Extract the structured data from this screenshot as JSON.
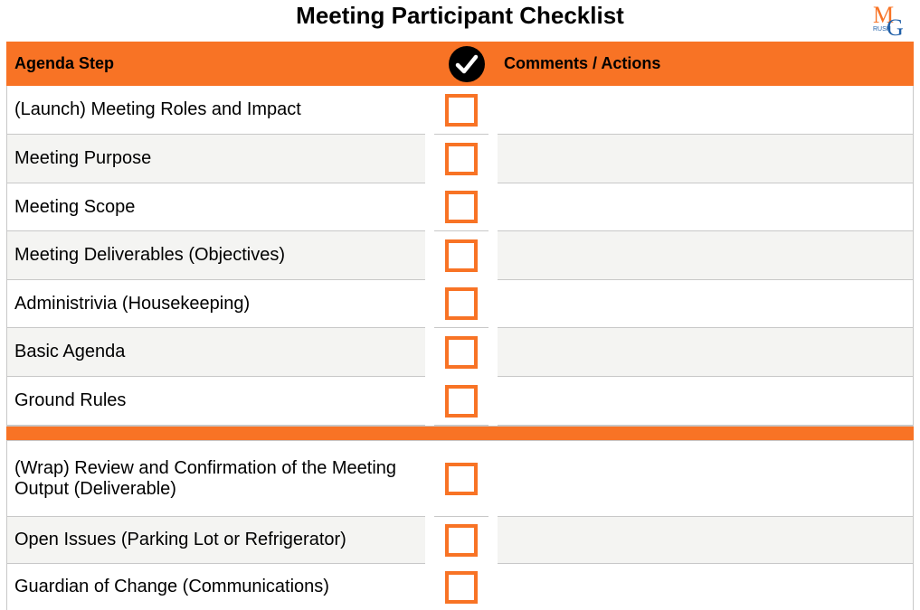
{
  "title": "Meeting Participant Checklist",
  "logo": {
    "name": "MG Rush logo",
    "letters": [
      "M",
      "G"
    ],
    "text": "RUSH",
    "colors": {
      "orange": "#f87325",
      "blue": "#1f5fa8"
    }
  },
  "colors": {
    "accent": "#f87325",
    "row_shade": "#f4f4f2",
    "grid": "#c8c8c8"
  },
  "header": {
    "agenda_step": "Agenda Step",
    "check_icon": "check-circle-icon",
    "comments": "Comments / Actions"
  },
  "launch_rows": [
    {
      "step": "(Launch) Meeting Roles and Impact",
      "checked": false,
      "comments": ""
    },
    {
      "step": "Meeting Purpose",
      "checked": false,
      "comments": ""
    },
    {
      "step": "Meeting Scope",
      "checked": false,
      "comments": ""
    },
    {
      "step": "Meeting Deliverables (Objectives)",
      "checked": false,
      "comments": ""
    },
    {
      "step": "Administrivia (Housekeeping)",
      "checked": false,
      "comments": ""
    },
    {
      "step": "Basic Agenda",
      "checked": false,
      "comments": ""
    },
    {
      "step": "Ground Rules",
      "checked": false,
      "comments": ""
    }
  ],
  "wrap_rows": [
    {
      "step": "(Wrap) Review and Confirmation of the Meeting Output (Deliverable)",
      "checked": false,
      "comments": ""
    },
    {
      "step": "Open Issues (Parking Lot or Refrigerator)",
      "checked": false,
      "comments": ""
    },
    {
      "step": "Guardian of Change (Communications)",
      "checked": false,
      "comments": ""
    }
  ]
}
